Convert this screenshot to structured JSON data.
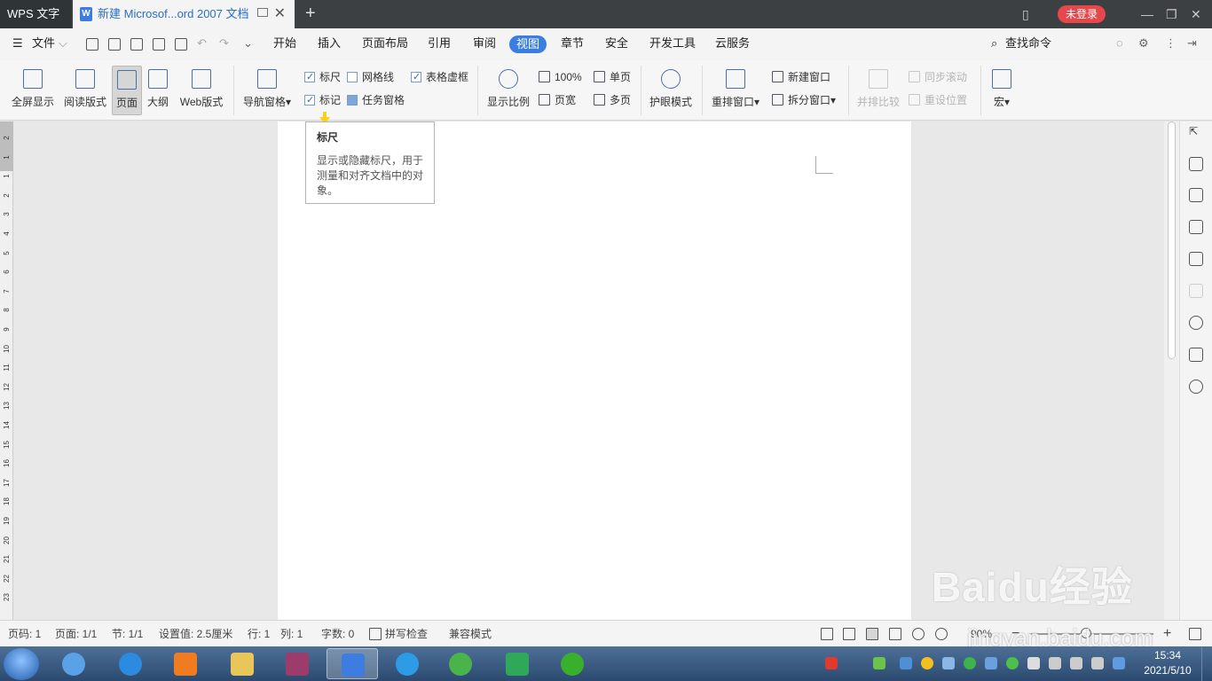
{
  "titlebar": {
    "app_name": "WPS 文字",
    "doc_tab": "新建 Microsof...ord 2007 文档",
    "add_tab": "+",
    "login": "未登录"
  },
  "menubar": {
    "file": "文件",
    "tabs": [
      "开始",
      "插入",
      "页面布局",
      "引用",
      "审阅",
      "视图",
      "章节",
      "安全",
      "开发工具",
      "云服务"
    ],
    "active_tab": "视图",
    "search_cmd": "查找命令"
  },
  "ribbon": {
    "fullscreen": "全屏显示",
    "read_mode": "阅读版式",
    "page": "页面",
    "outline": "大纲",
    "web_mode": "Web版式",
    "nav_pane": "导航窗格",
    "ruler": "标尺",
    "gridlines": "网格线",
    "table_gridlines": "表格虚框",
    "markup": "标记",
    "task_pane": "任务窗格",
    "zoom": "显示比例",
    "zoom_100": "100%",
    "page_width": "页宽",
    "single_page": "单页",
    "multi_page": "多页",
    "eye_protect": "护眼模式",
    "arrange": "重排窗口",
    "new_window": "新建窗口",
    "split_window": "拆分窗口",
    "side_by_side": "并排比较",
    "sync_scroll": "同步滚动",
    "reset_position": "重设位置",
    "macro": "宏",
    "checkbox_state": {
      "ruler": true,
      "gridlines": false,
      "table_gridlines": true,
      "markup": true,
      "task_pane": false
    }
  },
  "tooltip": {
    "title": "标尺",
    "body": "显示或隐藏标尺，用于测量和对齐文档中的对象。"
  },
  "ruler_numbers": [
    "2",
    "1",
    "1",
    "2",
    "3",
    "4",
    "5",
    "6",
    "7",
    "8",
    "9",
    "10",
    "11",
    "12",
    "13",
    "14",
    "15",
    "16",
    "17",
    "18",
    "19",
    "20",
    "21",
    "22",
    "23"
  ],
  "statusbar": {
    "page": "页码: 1",
    "pages": "页面: 1/1",
    "section": "节: 1/1",
    "setting": "设置值: 2.5厘米",
    "row": "行: 1",
    "col": "列: 1",
    "word_count": "字数: 0",
    "spell_check": "拼写检查",
    "compat_mode": "兼容模式",
    "zoom": "90%"
  },
  "watermark": {
    "logo": "Baidu经验",
    "url": "jingyan.baidu.com"
  },
  "taskbar": {
    "time": "15:34",
    "date": "2021/5/10"
  }
}
